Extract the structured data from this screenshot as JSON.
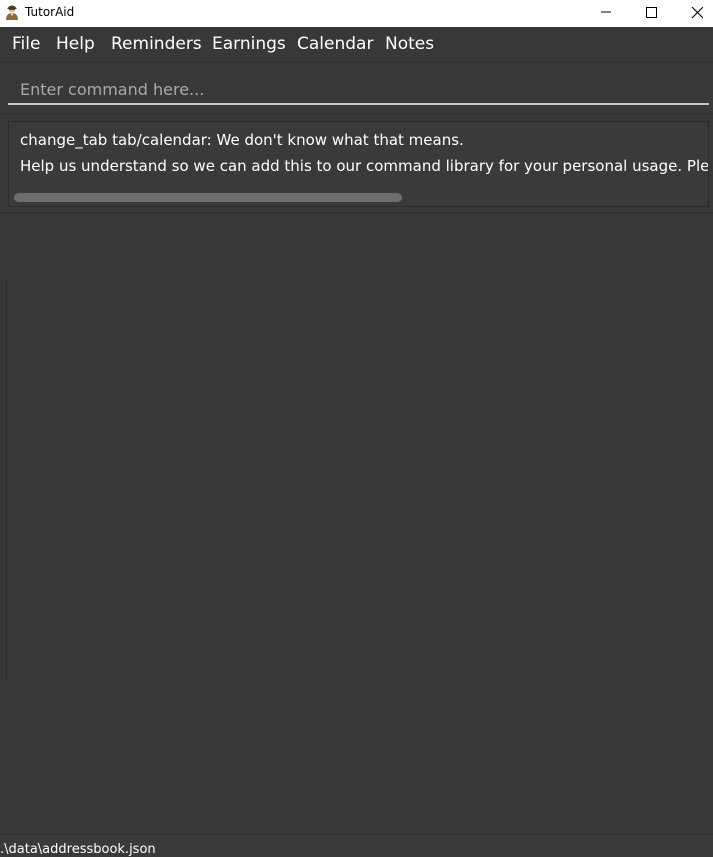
{
  "window": {
    "title": "TutorAid",
    "icon": "tutor-avatar-icon",
    "controls": {
      "minimize_icon": "minimize-icon",
      "maximize_icon": "maximize-icon",
      "close_icon": "close-icon"
    }
  },
  "menu": {
    "items": [
      {
        "label": "File"
      },
      {
        "label": "Help"
      },
      {
        "label": "Reminders"
      },
      {
        "label": "Earnings"
      },
      {
        "label": "Calendar"
      },
      {
        "label": "Notes"
      }
    ]
  },
  "command": {
    "placeholder": "Enter command here...",
    "value": ""
  },
  "result": {
    "line1": "change_tab tab/calendar: We don't know what that means.",
    "line2": "Help us understand so we can add this to our command library for your personal usage. Please"
  },
  "status": {
    "path": ".\\data\\addressbook.json"
  },
  "colors": {
    "background": "#383838",
    "text": "#ffffff",
    "titlebar": "#ffffff"
  }
}
